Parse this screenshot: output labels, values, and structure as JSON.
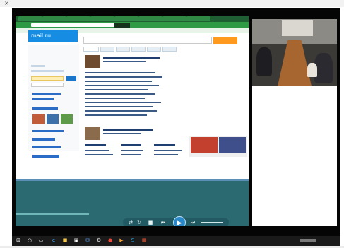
{
  "window": {
    "close_glyph": "×"
  },
  "browser": {
    "tabs": [
      "",
      "",
      "",
      "",
      "",
      "",
      "",
      ""
    ],
    "logo_text": "mail.ru"
  },
  "player": {
    "controls": {
      "shuffle": "⇄",
      "repeat": "↻",
      "stop": "■",
      "prev": "⏮",
      "play": "▶",
      "next": "⏭",
      "mute": "🔊"
    }
  },
  "taskbar": {
    "icons": [
      "start-icon",
      "search-icon",
      "task-view-icon",
      "edge-icon",
      "file-explorer-icon",
      "store-icon",
      "mail-icon",
      "settings-icon",
      "chrome-icon",
      "media-player-icon",
      "skype-icon",
      "photos-icon"
    ],
    "time": "",
    "date": ""
  },
  "colors": {
    "browser_green": "#2f9a45",
    "player_teal": "#2a6a70",
    "accent_orange": "#ff9a1f",
    "link_blue": "#168de2"
  }
}
